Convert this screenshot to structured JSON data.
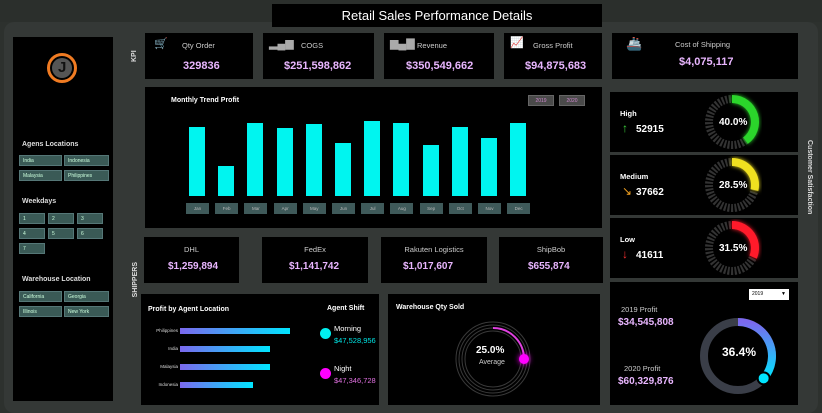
{
  "title": "Retail Sales Performance Details",
  "sidebar": {
    "agens_title": "Agens Locations",
    "agens": [
      "India",
      "Indonesia",
      "Malaysia",
      "Philippines"
    ],
    "weekdays_title": "Weekdays",
    "weekdays": [
      "1",
      "2",
      "3",
      "4",
      "5",
      "6",
      "7"
    ],
    "warehouse_title": "Warehouse Location",
    "warehouses": [
      "California",
      "Georgia",
      "Illinois",
      "New York"
    ]
  },
  "kpi": {
    "label": "KPI",
    "qty_order": {
      "label": "Qty Order",
      "value": "329836"
    },
    "cogs": {
      "label": "COGS",
      "value": "$251,598,862"
    },
    "revenue": {
      "label": "Revenue",
      "value": "$350,549,662"
    },
    "gross_profit": {
      "label": "Gross Profit",
      "value": "$94,875,683"
    },
    "shipping": {
      "label": "Cost of Shipping",
      "value": "$4,075,117"
    }
  },
  "trend": {
    "title": "Monthly Trend Profit",
    "buttons": [
      "2019",
      "2020"
    ]
  },
  "chart_data": {
    "type": "bar",
    "title": "Monthly Trend Profit",
    "categories": [
      "Jan",
      "Feb",
      "Mar",
      "Apr",
      "May",
      "Jun",
      "Jul",
      "Aug",
      "Sep",
      "Oct",
      "Nov",
      "Dec"
    ],
    "values": [
      0.89,
      0.39,
      0.94,
      0.87,
      0.92,
      0.68,
      0.96,
      0.94,
      0.65,
      0.89,
      0.74,
      0.93
    ]
  },
  "satisfaction": {
    "label": "Customer Satisfaction",
    "items": [
      {
        "name": "High",
        "count": "52915",
        "pct": "40.0%",
        "fraction": 0.4,
        "color": "#2bd52b",
        "arrow": "↑",
        "arrow_color": "#3cd03c"
      },
      {
        "name": "Medium",
        "count": "37662",
        "pct": "28.5%",
        "fraction": 0.285,
        "color": "#f0e020",
        "arrow": "↘",
        "arrow_color": "#f0a020"
      },
      {
        "name": "Low",
        "count": "41611",
        "pct": "31.5%",
        "fraction": 0.315,
        "color": "#ff1a2a",
        "arrow": "↓",
        "arrow_color": "#ff3030"
      }
    ]
  },
  "shippers": {
    "label": "SHIPPERS",
    "items": [
      {
        "name": "DHL",
        "value": "$1,259,894"
      },
      {
        "name": "FedEx",
        "value": "$1,141,742"
      },
      {
        "name": "Rakuten Logistics",
        "value": "$1,017,607"
      },
      {
        "name": "ShipBob",
        "value": "$655,874"
      }
    ]
  },
  "agent": {
    "title": "Profit by Agent Location",
    "bars": [
      {
        "name": "Philippines",
        "fraction": 1.0
      },
      {
        "name": "India",
        "fraction": 0.82
      },
      {
        "name": "Malaysia",
        "fraction": 0.82
      },
      {
        "name": "Indonesia",
        "fraction": 0.66
      }
    ],
    "shift_title": "Agent Shift",
    "morning": {
      "label": "Morning",
      "value": "$47,528,956",
      "color": "#00f0f0"
    },
    "night": {
      "label": "Night",
      "value": "$47,346,728",
      "color": "#ff00ff"
    }
  },
  "warehouse": {
    "title": "Warehouse Qty Sold",
    "pct": "25.0%",
    "sub": "Average",
    "fraction": 0.25
  },
  "profit": {
    "year_select": "2019",
    "p2019_label": "2019 Profit",
    "p2019_value": "$34,545,808",
    "p2020_label": "2020 Profit",
    "p2020_value": "$60,329,876",
    "pct": "36.4%",
    "fraction": 0.364
  }
}
